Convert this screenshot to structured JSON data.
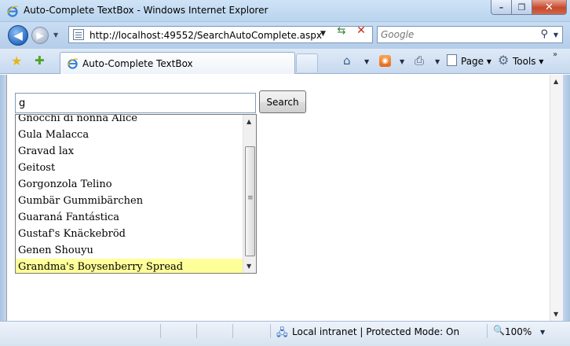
{
  "window": {
    "title": "Auto-Complete TextBox - Windows Internet Explorer",
    "min_label": "–",
    "max_label": "❐",
    "close_label": "✕"
  },
  "address_bar": {
    "url": "http://localhost:49552/SearchAutoComplete.aspx",
    "search_placeholder": "Google"
  },
  "tabs": [
    {
      "label": "Auto-Complete TextBox",
      "active": true
    }
  ],
  "command_bar": {
    "page_label": "Page",
    "tools_label": "Tools"
  },
  "page": {
    "search_value": "g",
    "search_button_label": "Search",
    "suggestions": [
      "Gnocchi di nonna Alice",
      "Gula Malacca",
      "Gravad lax",
      "Geitost",
      "Gorgonzola Telino",
      "Gumbär Gummibärchen",
      "Guaraná Fantástica",
      "Gustaf's Knäckebröd",
      "Genen Shouyu",
      "Grandma's Boysenberry Spread"
    ],
    "selected_index": 9
  },
  "status_bar": {
    "zone": "Local intranet | Protected Mode: On",
    "zoom": "100%"
  },
  "colors": {
    "selected_suggestion": "#ffff99",
    "window_frame": "#b9d4ee"
  },
  "icons": [
    "ie-logo-icon",
    "back-arrow-icon",
    "forward-arrow-icon",
    "refresh-icon",
    "stop-icon",
    "search-icon",
    "favorites-star-icon",
    "add-favorite-icon",
    "home-icon",
    "rss-feed-icon",
    "print-icon",
    "page-icon",
    "tools-gear-icon",
    "intranet-zone-icon",
    "zoom-icon"
  ]
}
